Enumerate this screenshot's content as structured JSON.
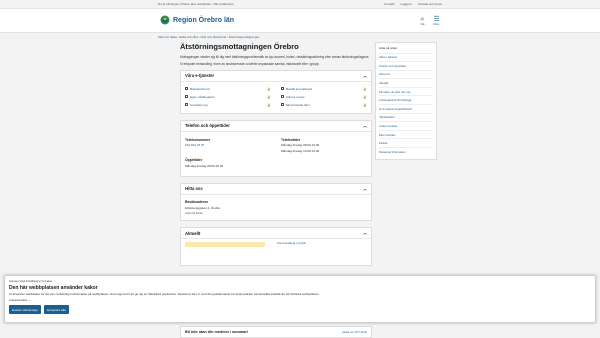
{
  "topbar": {
    "notice": "Du är på Region Örebro läns webbplats - Mitt webbkonto",
    "links": [
      "Kontakt",
      "Logga in",
      "Kontakt och press"
    ]
  },
  "header": {
    "brand": "Region Örebro län",
    "search_label": "Sök",
    "menu_label": "Meny",
    "accent": "#1b5e8f"
  },
  "breadcrumb": "Start och hälsa › Hälsa och vård › Vård och vårdcentral › Ätstörningsmottagningen",
  "page": {
    "title": "Ätstörningsmottagningen Örebro",
    "lead": "Mottagningen vänder sig till dig med ätstörningsproblematik av typ anorexi, bulimi, hetsätningsstörning eller annan ätstörningsdiagnos.",
    "lead2": "Vi erbjuder behandling i form av strukturerade och/eller anpassade samtal, individuellt eller i grupp."
  },
  "eservices": {
    "title": "Våra e-tjänster",
    "items": [
      {
        "label": "Boka/Ändra tid"
      },
      {
        "label": "Beställ journalkopia"
      },
      {
        "label": "Egen vårdbegäran"
      },
      {
        "label": "Förnya recept"
      },
      {
        "label": "Kontakta mig"
      },
      {
        "label": "Mina bokade tider"
      }
    ]
  },
  "phone": {
    "title": "Telefon och öppettider",
    "number_label": "Telefonnummer",
    "number": "019-602 25 87",
    "hours_label": "Telefontider",
    "hours_1": "Måndag-Fredag 08:00-10:00",
    "hours_2": "Måndag-Fredag 13:00-14:30",
    "open_label": "Öppettider",
    "open": "Måndag-Fredag 08:00-16:30"
  },
  "find": {
    "title": "Hitta oss",
    "visit_label": "Besöksadress",
    "visit": "Eriksbergsgatan 4, Örebro",
    "map_link": "Visa på karta"
  },
  "news": {
    "title": "Aktuellt",
    "link": "Sommarstängt i juni/juli"
  },
  "sidebar": {
    "title": "Hitta på sidan",
    "items": [
      "Våra e-tjänster",
      "Telefon och öppettider",
      "Hitta oss",
      "Aktuellt",
      "Så söker du vård hos oss",
      "Anhöriga/stöd till anhöriga",
      "Är du ätstörningsdrabbad?",
      "Vårdbesöket",
      "Under besöket",
      "Efter besöket",
      "Länkar",
      "Relaterad information"
    ]
  },
  "cookie": {
    "small": "Hantera dina inställningar för kakor",
    "title": "Den här webbplatsen använder kakor",
    "text": "Vi använder webbkakor för att viss nödvändig funktionalitet på webbplatsen ska fungera för att ge dig en förbättrad upplevelse. Dessutom kan vi med ditt godkännande för analyssakser samanställa statistik för att förbättra webbplatsen.",
    "more": "Anpassa kakor ⌄",
    "btn_necessary": "Endast nödvändiga",
    "btn_accept": "Acceptera alla"
  },
  "bottom": {
    "question": "Bli inte utan din medicin i sommar!",
    "link": "Ladda ner 1177 direkt"
  }
}
